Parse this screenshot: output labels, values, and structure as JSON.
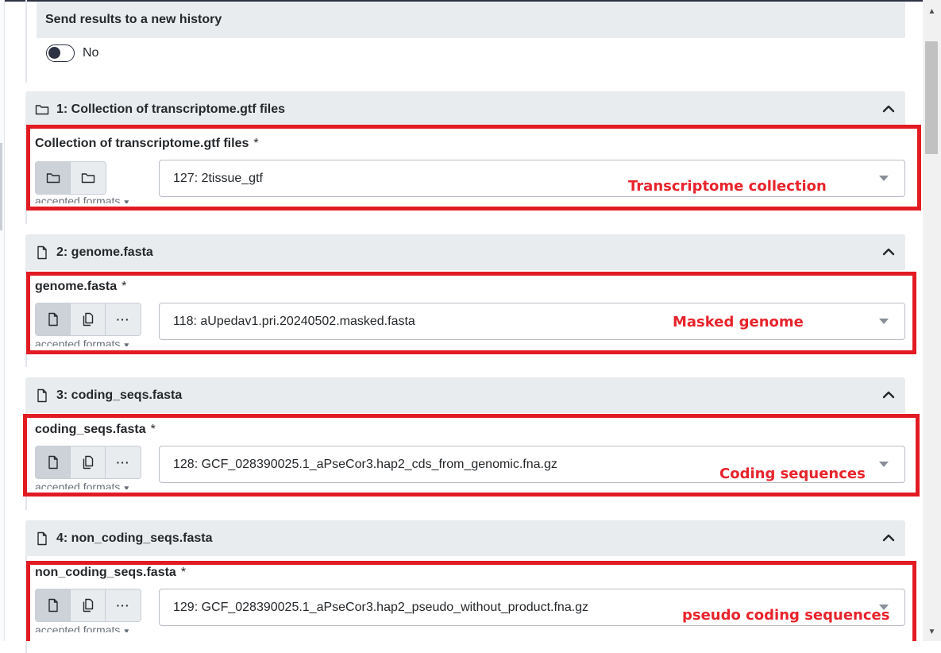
{
  "send_results": {
    "title": "Send results to a new history",
    "toggle_label": "No",
    "toggle_on": false
  },
  "sections": [
    {
      "header": "1: Collection of transcriptome.gtf files",
      "header_icon": "folder-icon",
      "field_label": "Collection of transcriptome.gtf files",
      "required_mark": "*",
      "buttons": [
        "folder-icon",
        "folder-icon"
      ],
      "active_button": 0,
      "accepted_formats": "accepted formats",
      "selected_value": "127: 2tissue_gtf",
      "annotation": "Transcriptome collection"
    },
    {
      "header": "2: genome.fasta",
      "header_icon": "file-icon",
      "field_label": "genome.fasta",
      "required_mark": "*",
      "buttons": [
        "file-icon",
        "files-icon",
        "ellipsis"
      ],
      "active_button": 0,
      "accepted_formats": "accepted formats",
      "selected_value": "118: aUpedav1.pri.20240502.masked.fasta",
      "annotation": "Masked genome"
    },
    {
      "header": "3: coding_seqs.fasta",
      "header_icon": "file-icon",
      "field_label": "coding_seqs.fasta",
      "required_mark": "*",
      "buttons": [
        "file-icon",
        "files-icon",
        "ellipsis"
      ],
      "active_button": 0,
      "accepted_formats": "accepted formats",
      "selected_value": "128: GCF_028390025.1_aPseCor3.hap2_cds_from_genomic.fna.gz",
      "annotation": "Coding sequences"
    },
    {
      "header": "4: non_coding_seqs.fasta",
      "header_icon": "file-icon",
      "field_label": "non_coding_seqs.fasta",
      "required_mark": "*",
      "buttons": [
        "file-icon",
        "files-icon",
        "ellipsis"
      ],
      "active_button": 0,
      "accepted_formats": "accepted formats",
      "selected_value": "129: GCF_028390025.1_aPseCor3.hap2_pseudo_without_product.fna.gz",
      "annotation": "pseudo coding sequences"
    }
  ],
  "colors": {
    "annotation_red": "#e21b23",
    "header_bg": "#e9ecef",
    "text": "#25282b"
  }
}
